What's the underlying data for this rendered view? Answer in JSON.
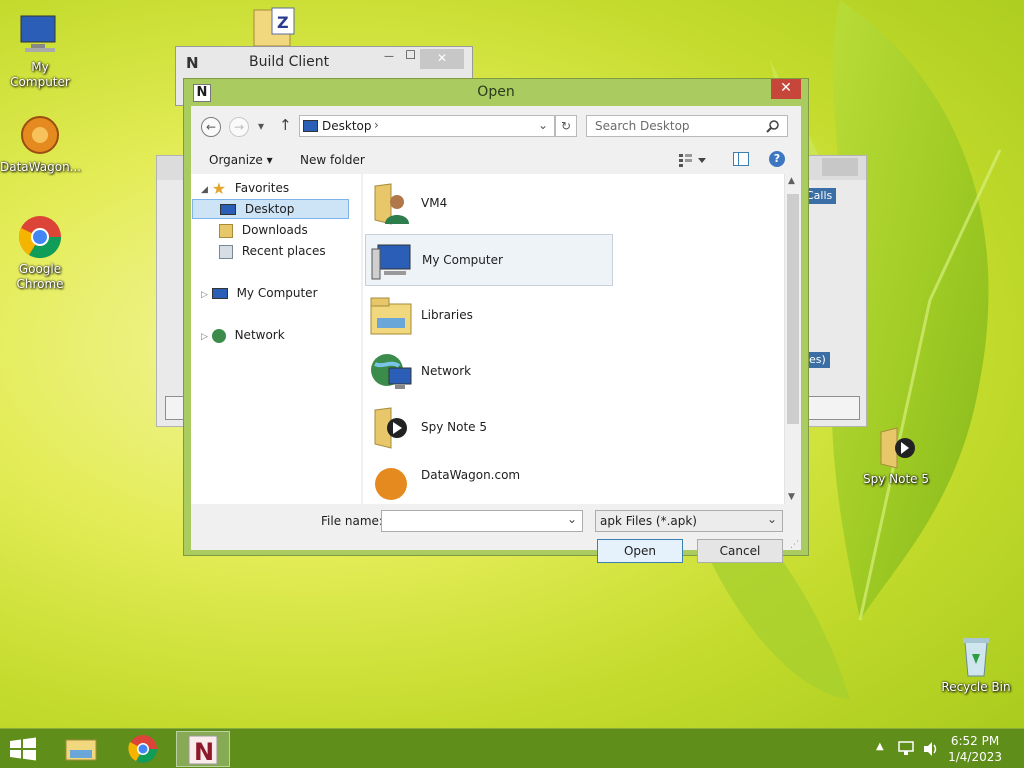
{
  "desktop": {
    "icons": [
      {
        "label": "My Computer"
      },
      {
        "label": "DataWagon..."
      },
      {
        "label": "Google Chrome"
      },
      {
        "label": "Spy Note 5"
      },
      {
        "label": "Recycle Bin"
      }
    ]
  },
  "build_client": {
    "title": "Build Client",
    "minimize": "—",
    "maximize": "☐",
    "close": "✕"
  },
  "background_window": {
    "snippet_calls": "Calls",
    "snippet_es": "es)"
  },
  "dialog": {
    "title": "Open",
    "close": "✕",
    "nav": {
      "back": "←",
      "forward": "→",
      "dropdown": "▾",
      "up": "↑",
      "address": "Desktop",
      "address_arrow": "›",
      "refresh": "↻",
      "search_placeholder": "Search Desktop"
    },
    "toolbar": {
      "organize": "Organize ▾",
      "new_folder": "New folder",
      "help": "?"
    },
    "tree": {
      "favorites": "Favorites",
      "desktop": "Desktop",
      "downloads": "Downloads",
      "recent": "Recent places",
      "my_computer": "My Computer",
      "network": "Network"
    },
    "files": [
      {
        "name": "VM4"
      },
      {
        "name": "My Computer"
      },
      {
        "name": "Libraries"
      },
      {
        "name": "Network"
      },
      {
        "name": "Spy Note 5"
      },
      {
        "name": "DataWagon.com"
      }
    ],
    "bottom": {
      "file_name_label": "File name:",
      "file_name_value": "",
      "file_type": "apk Files (*.apk)",
      "open": "Open",
      "cancel": "Cancel"
    }
  },
  "taskbar": {
    "time": "6:52 PM",
    "date": "1/4/2023"
  },
  "colors": {
    "dialog_frame": "#a9cb5f",
    "close_red": "#c7463a",
    "taskbar": "#5f8e1b",
    "selection": "#cde4f7"
  }
}
